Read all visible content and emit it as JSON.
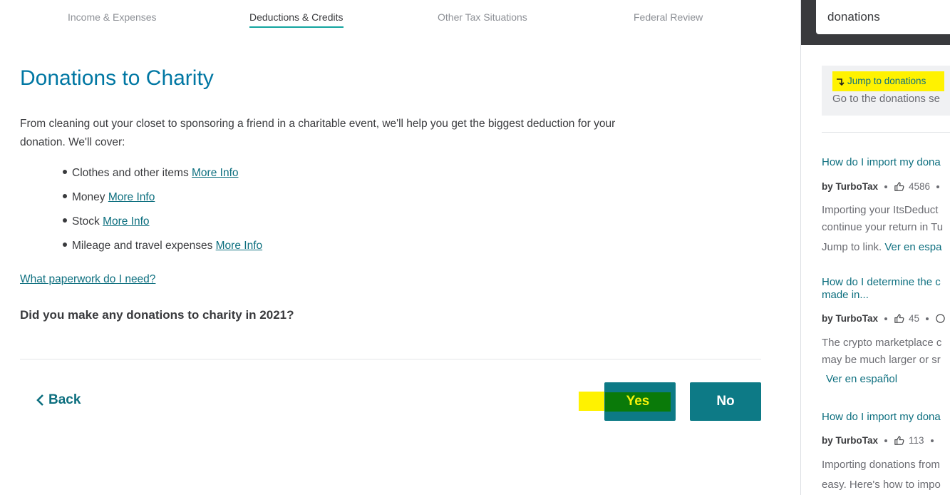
{
  "nav": {
    "tabs": [
      {
        "label": "Income & Expenses"
      },
      {
        "label": "Deductions & Credits"
      },
      {
        "label": "Other Tax Situations"
      },
      {
        "label": "Federal Review"
      }
    ]
  },
  "main": {
    "title": "Donations to Charity",
    "intro": "From cleaning out your closet to sponsoring a friend in a charitable event, we'll help you get the biggest deduction for your donation. We'll cover:",
    "items": [
      {
        "label": "Clothes and other items",
        "link": "More Info"
      },
      {
        "label": "Money",
        "link": "More Info"
      },
      {
        "label": "Stock",
        "link": "More Info"
      },
      {
        "label": "Mileage and travel expenses",
        "link": "More Info"
      }
    ],
    "paperwork_link": "What paperwork do I need?",
    "question": "Did you make any donations to charity in 2021?",
    "back_label": "Back",
    "yes_label": "Yes",
    "no_label": "No"
  },
  "panel": {
    "search_value": "donations",
    "jump_link": "Jump to donations",
    "jump_sub": "Go to the donations se",
    "results": [
      {
        "title": "How do I import my dona",
        "by": "by TurboTax",
        "likes": "4586",
        "snippet_lines": [
          "Importing your ItsDeduct",
          "continue your return in Tu",
          "Jump to link."
        ],
        "ver": "Ver en espa"
      },
      {
        "title_lines": [
          "How do I determine the c",
          "made in..."
        ],
        "by": "by TurboTax",
        "likes": "45",
        "snippet_lines": [
          "The crypto marketplace c",
          "may be much larger or sr"
        ],
        "ver": "Ver en español"
      },
      {
        "title": "How do I import my dona",
        "by": "by TurboTax",
        "likes": "113",
        "snippet_lines": [
          "Importing donations from",
          "easy. Here's how to impo"
        ]
      }
    ]
  }
}
